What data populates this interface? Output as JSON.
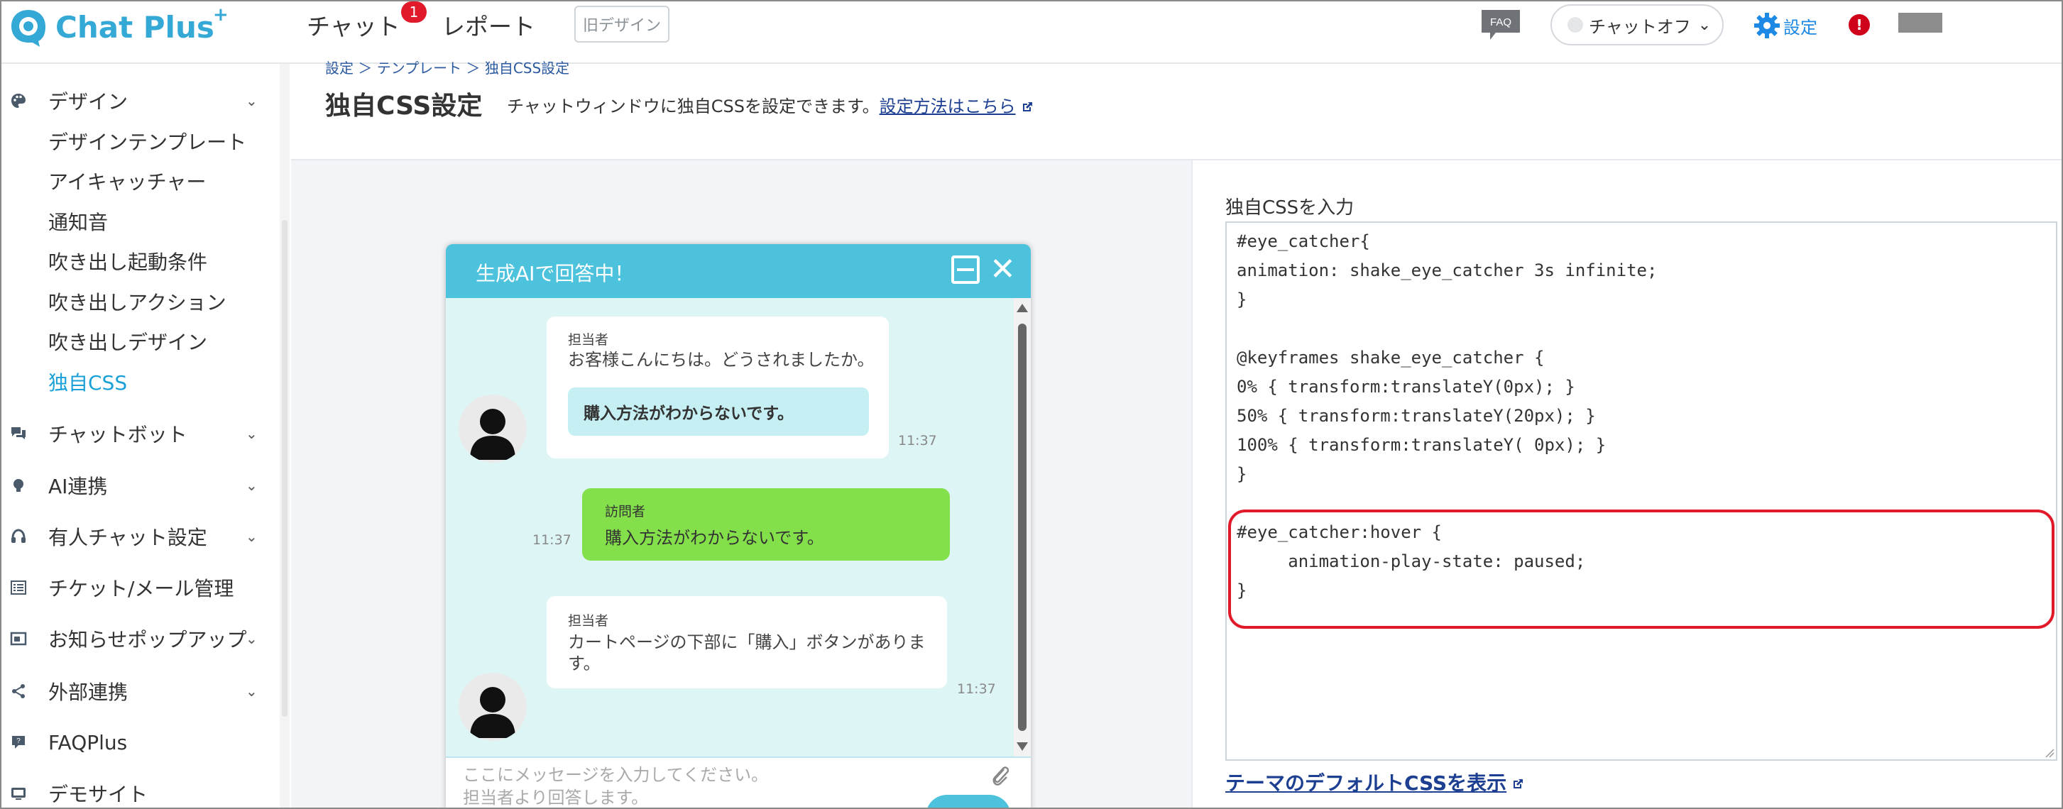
{
  "app": {
    "logo_text": "Chat Plus",
    "logo_plus": "+",
    "brand_color": "#34a9d6",
    "accent_color": "#1ba1d7",
    "danger_color": "#e0192b"
  },
  "header": {
    "nav": [
      {
        "label": "チャット",
        "badge": "1"
      },
      {
        "label": "レポート"
      }
    ],
    "old_design_label": "旧デザイン",
    "faq_label": "FAQ",
    "status_label": "チャットオフ",
    "settings_label": "設定",
    "alert_label": "!"
  },
  "sidebar": {
    "groups": [
      {
        "label": "デザイン",
        "icon": "palette-icon",
        "expanded": true
      },
      {
        "label": "チャットボット",
        "icon": "chat-bubbles-icon"
      },
      {
        "label": "AI連携",
        "icon": "lightbulb-icon"
      },
      {
        "label": "有人チャット設定",
        "icon": "headset-icon"
      },
      {
        "label": "チケット/メール管理",
        "icon": "list-icon"
      },
      {
        "label": "お知らせポップアップ",
        "icon": "popup-icon"
      },
      {
        "label": "外部連携",
        "icon": "share-icon"
      },
      {
        "label": "FAQPlus",
        "icon": "faqplus-icon"
      },
      {
        "label": "デモサイト",
        "icon": "monitor-icon"
      }
    ],
    "design_subitems": [
      "デザインテンプレート",
      "アイキャッチャー",
      "通知音",
      "吹き出し起動条件",
      "吹き出しアクション",
      "吹き出しデザイン",
      "独自CSS"
    ]
  },
  "page": {
    "breadcrumb": "設定 ＞ テンプレート ＞ 独自CSS設定",
    "title": "独自CSS設定",
    "description": "チャットウィンドウに独自CSSを設定できます。",
    "help_link": "設定方法はこちら"
  },
  "chat_preview": {
    "title": "生成AIで回答中！",
    "operator_label": "担当者",
    "visitor_label": "訪問者",
    "messages": [
      {
        "role": "operator",
        "text": "お客様こんにちは。どうされましたか。",
        "choice": "購入方法がわからないです。",
        "time": "11:37"
      },
      {
        "role": "visitor",
        "text": "購入方法がわからないです。",
        "time": "11:37"
      },
      {
        "role": "operator",
        "text": "カートページの下部に「購入」ボタンがありま",
        "text2": "す。",
        "time": "11:37"
      }
    ],
    "input_placeholder_1": "ここにメッセージを入力してください。",
    "input_placeholder_2": "担当者より回答します。"
  },
  "css_editor": {
    "label": "独自CSSを入力",
    "lines": [
      "#eye_catcher{",
      "animation: shake_eye_catcher 3s infinite;",
      "}",
      "",
      "@keyframes shake_eye_catcher {",
      "0% { transform:translateY(0px); }",
      "50% { transform:translateY(20px); }",
      "100% { transform:translateY( 0px); }",
      "}",
      "",
      "#eye_catcher:hover {",
      "     animation-play-state: paused;",
      "}"
    ],
    "default_css_link": "テーマのデフォルトCSSを表示"
  }
}
